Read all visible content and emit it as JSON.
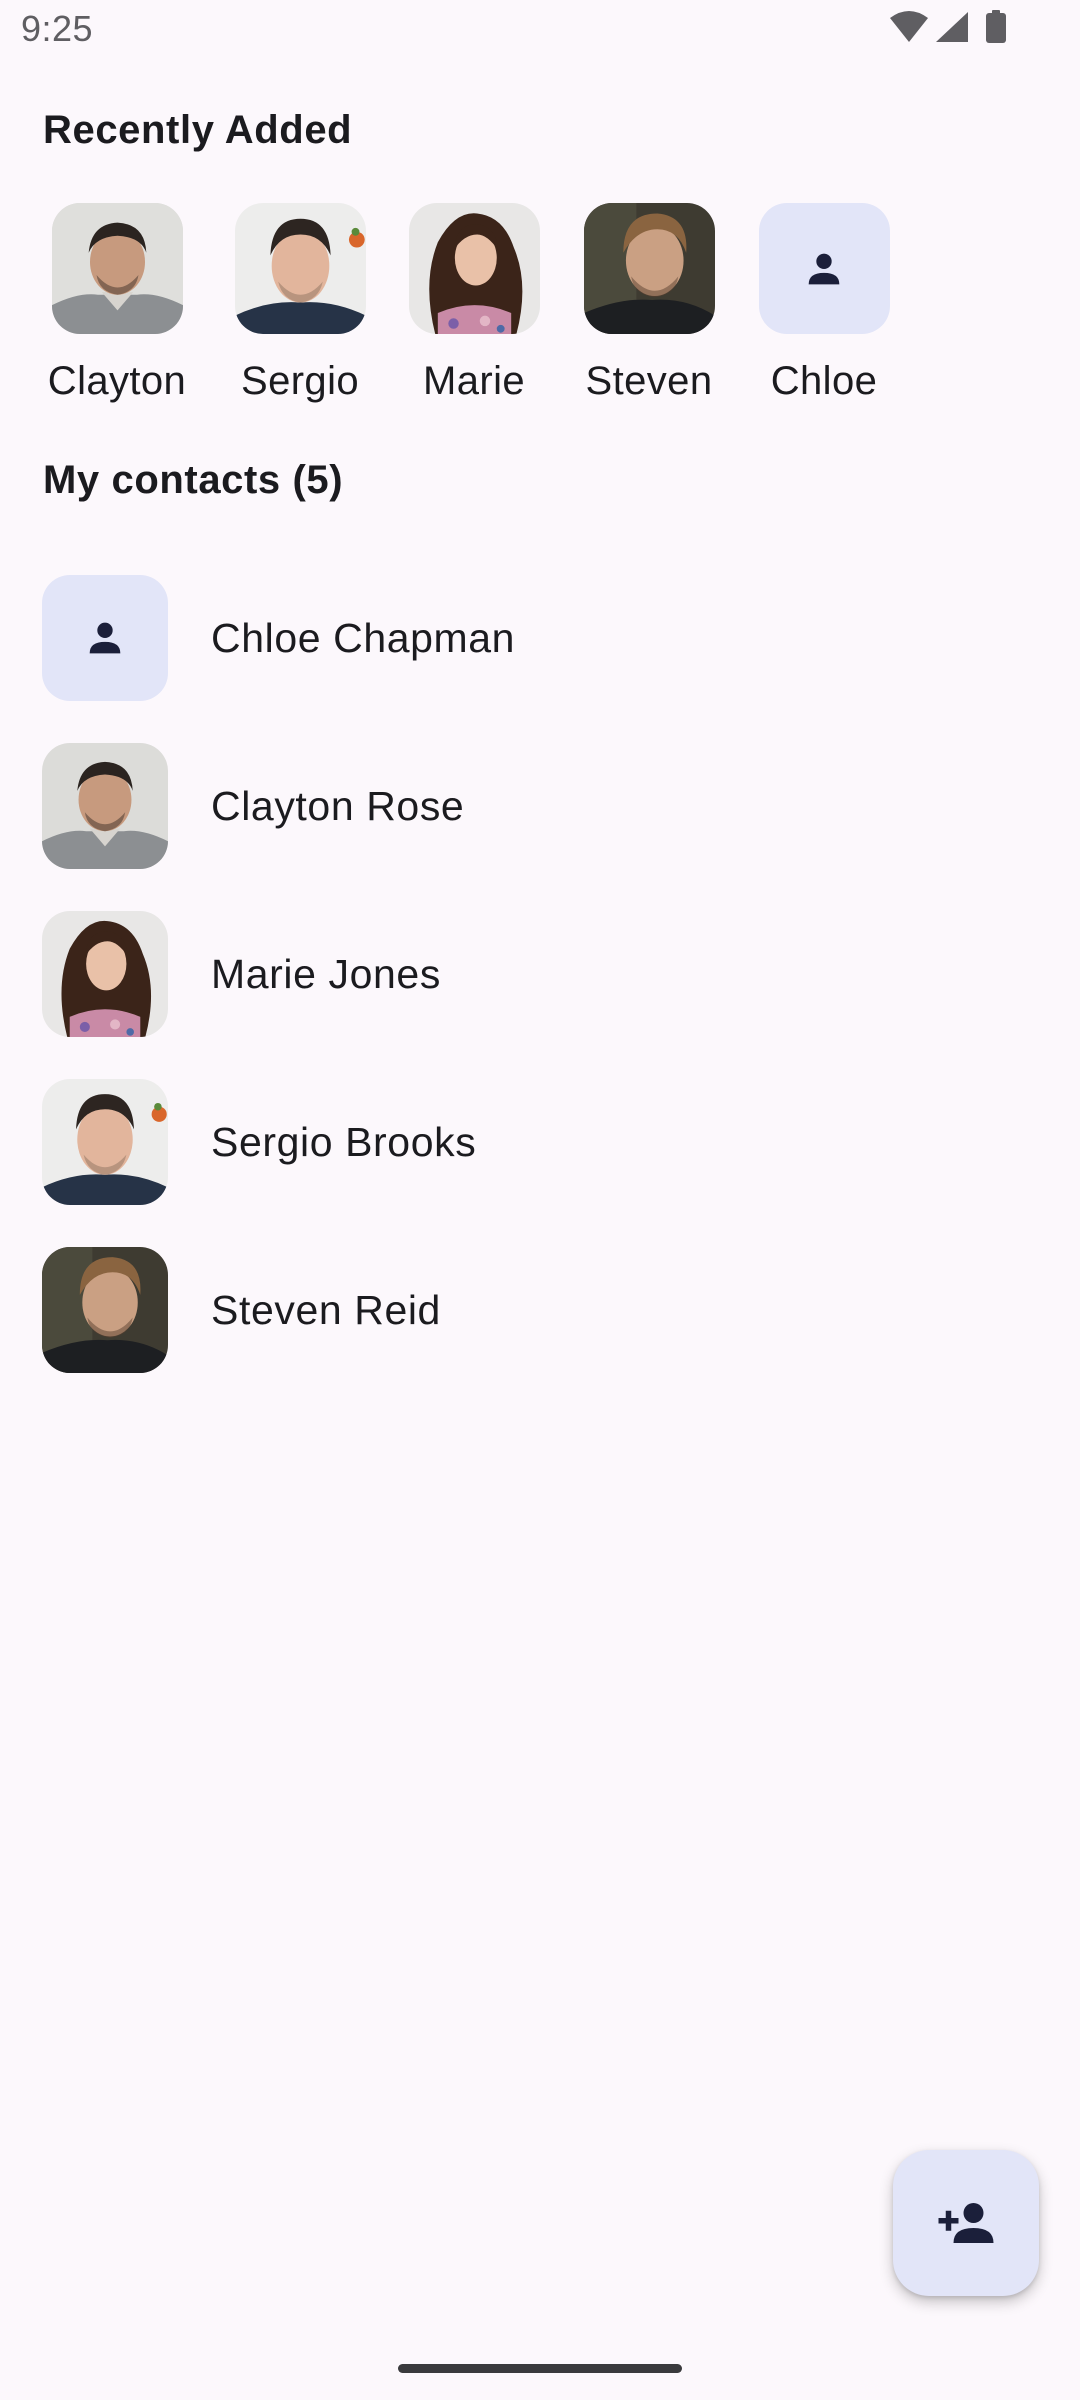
{
  "status_bar": {
    "time": "9:25",
    "icons": [
      "wifi-icon",
      "cellular-signal-icon",
      "battery-icon"
    ]
  },
  "recently_added": {
    "title": "Recently Added",
    "items": [
      {
        "name": "Clayton",
        "avatar": "photo"
      },
      {
        "name": "Sergio",
        "avatar": "photo"
      },
      {
        "name": "Marie",
        "avatar": "photo"
      },
      {
        "name": "Steven",
        "avatar": "photo"
      },
      {
        "name": "Chloe",
        "avatar": "person-icon"
      }
    ]
  },
  "contacts": {
    "title": "My contacts (5)",
    "items": [
      {
        "name": "Chloe Chapman",
        "avatar": "person-icon"
      },
      {
        "name": "Clayton Rose",
        "avatar": "photo"
      },
      {
        "name": "Marie Jones",
        "avatar": "photo"
      },
      {
        "name": "Sergio Brooks",
        "avatar": "photo"
      },
      {
        "name": "Steven Reid",
        "avatar": "photo"
      }
    ]
  },
  "fab": {
    "icon": "add-person-icon"
  },
  "colors": {
    "background": "#fcf8fc",
    "placeholder_avatar_bg": "#e2e5f8",
    "icon_dark": "#1b1f3a",
    "text_primary": "#1b1b1f"
  }
}
